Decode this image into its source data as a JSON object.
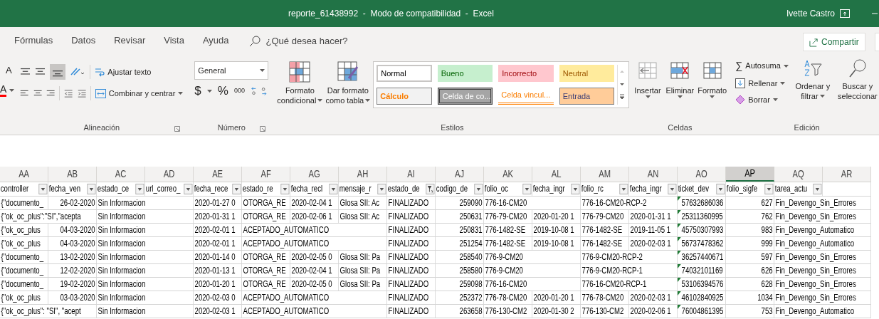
{
  "window": {
    "title": "reporte_61438992  -  Modo de compatibilidad  -  Excel",
    "user": "Ivette Castro"
  },
  "tabs": [
    {
      "label": "Fórmulas",
      "selected": false
    },
    {
      "label": "Datos",
      "selected": false
    },
    {
      "label": "Revisar",
      "selected": false
    },
    {
      "label": "Vista",
      "selected": false
    },
    {
      "label": "Ayuda",
      "selected": false
    }
  ],
  "search": {
    "placeholder": "¿Qué desea hacer?"
  },
  "share_button": "Compartir",
  "font_group": {
    "increase_size_letter": "A",
    "font_color_letter": "A"
  },
  "alignment_group": {
    "wrap_text": "Ajustar texto",
    "merge_center": "Combinar y centrar",
    "label": "Alineación"
  },
  "number_group": {
    "format": "General",
    "currency": "$",
    "percent": "%",
    "thousands": "000",
    "label": "Número"
  },
  "styles_group": {
    "conditional": [
      "Formato",
      "condicional"
    ],
    "as_table": [
      "Dar formato",
      "como tabla"
    ],
    "label": "Estilos",
    "cell_styles": [
      {
        "label": "Normal",
        "kind": "normal"
      },
      {
        "label": "Bueno",
        "kind": "good"
      },
      {
        "label": "Incorrecto",
        "kind": "bad"
      },
      {
        "label": "Neutral",
        "kind": "neutral"
      },
      {
        "label": "Cálculo",
        "kind": "calc"
      },
      {
        "label": "Celda de co...",
        "kind": "check"
      },
      {
        "label": "Celda vincul...",
        "kind": "linked"
      },
      {
        "label": "Entrada",
        "kind": "input"
      }
    ]
  },
  "cells_group": {
    "insert": "Insertar",
    "delete": "Eliminar",
    "format": "Formato",
    "label": "Celdas"
  },
  "editing_group": {
    "autosum_symbol": "∑",
    "autosum": "Autosuma",
    "fill": "Rellenar",
    "clear": "Borrar",
    "sort": [
      "Ordenar y",
      "filtrar"
    ],
    "find": [
      "Buscar y",
      "seleccionar"
    ],
    "label": "Edición"
  },
  "sheet": {
    "columns": [
      {
        "letter": "AA",
        "header": "controller",
        "kind": "text",
        "selected": false
      },
      {
        "letter": "AB",
        "header": "fecha_ven",
        "kind": "number",
        "selected": false
      },
      {
        "letter": "AC",
        "header": "estado_ce",
        "kind": "text",
        "selected": false
      },
      {
        "letter": "AD",
        "header": "url_correo_",
        "selected": false
      },
      {
        "letter": "AE",
        "header": "fecha_rece",
        "kind": "text",
        "selected": false
      },
      {
        "letter": "AF",
        "header": "estado_re",
        "kind": "text",
        "selected": false
      },
      {
        "letter": "AG",
        "header": "fecha_recl",
        "kind": "text",
        "selected": false
      },
      {
        "letter": "AH",
        "header": "mensaje_r",
        "kind": "text",
        "selected": false
      },
      {
        "letter": "AI",
        "header": "estado_de",
        "kind": "text",
        "selected": false,
        "filtered": true
      },
      {
        "letter": "AJ",
        "header": "codigo_de",
        "kind": "number",
        "selected": false
      },
      {
        "letter": "AK",
        "header": "folio_oc",
        "kind": "text",
        "selected": false
      },
      {
        "letter": "AL",
        "header": "fecha_ingr",
        "kind": "text",
        "selected": false
      },
      {
        "letter": "AM",
        "header": "folio_rc",
        "kind": "text",
        "selected": false
      },
      {
        "letter": "AN",
        "header": "fecha_ingr",
        "kind": "text",
        "selected": false
      },
      {
        "letter": "AO",
        "header": "ticket_dev",
        "kind": "text",
        "selected": false,
        "flagged": true
      },
      {
        "letter": "AP",
        "header": "folio_sigfe",
        "kind": "number",
        "selected": true
      },
      {
        "letter": "AQ",
        "header": "tarea_actu",
        "kind": "text",
        "selected": false
      },
      {
        "letter": "AR",
        "selected": false
      }
    ],
    "rows": [
      [
        "{\"documento_",
        "26-02-2020",
        "Sin Informacion",
        null,
        "2020-01-27 0",
        "OTORGA_RE",
        "2020-02-04 1",
        "Glosa SII: Ac",
        "FINALIZADO",
        "259090",
        "776-16-CM20",
        null,
        "776-16-CM20-RCP-2",
        null,
        "57632686036",
        "627",
        "Fin_Devengo_Sin_Errores",
        null
      ],
      [
        "{\"ok_oc_plus\":\"SI\",\"acepta",
        null,
        "Sin Informacion",
        null,
        "2020-01-31 1",
        "OTORGA_RE",
        "2020-02-06 1",
        "Glosa SII: Ac",
        "FINALIZADO",
        "250631",
        "776-79-CM20",
        "2020-01-20 1",
        "776-79-CM20",
        "2020-01-31 1",
        "25311360995",
        "762",
        "Fin_Devengo_Sin_Errores",
        null
      ],
      [
        "{\"ok_oc_plus",
        "04-03-2020",
        "Sin Informacion",
        null,
        "2020-02-01 1",
        "ACEPTADO_AUTOMATICO",
        null,
        null,
        "FINALIZADO",
        "250831",
        "776-1482-SE",
        "2019-10-08 1",
        "776-1482-SE",
        "2019-11-05 1",
        "45750307993",
        "983",
        "Fin_Devengo_Automatico",
        null
      ],
      [
        "{\"ok_oc_plus",
        "04-03-2020",
        "Sin Informacion",
        null,
        "2020-02-01 1",
        "ACEPTADO_AUTOMATICO",
        null,
        null,
        "FINALIZADO",
        "251254",
        "776-1482-SE",
        "2019-10-08 1",
        "776-1482-SE",
        "2020-02-03 1",
        "56737478362",
        "999",
        "Fin_Devengo_Automatico",
        null
      ],
      [
        "{\"documento_",
        "13-02-2020",
        "Sin Informacion",
        null,
        "2020-01-14 0",
        "OTORGA_RE",
        "2020-02-05 0",
        "Glosa SII: Pa",
        "FINALIZADO",
        "258540",
        "776-9-CM20",
        null,
        "776-9-CM20-RCP-2",
        null,
        "36257440671",
        "597",
        "Fin_Devengo_Sin_Errores",
        null
      ],
      [
        "{\"documento_",
        "12-02-2020",
        "Sin Informacion",
        null,
        "2020-01-13 1",
        "OTORGA_RE",
        "2020-02-04 1",
        "Glosa SII: Pa",
        "FINALIZADO",
        "258580",
        "776-9-CM20",
        null,
        "776-9-CM20-RCP-1",
        null,
        "74032101169",
        "626",
        "Fin_Devengo_Sin_Errores",
        null
      ],
      [
        "{\"documento_",
        "19-02-2020",
        "Sin Informacion",
        null,
        "2020-01-20 1",
        "OTORGA_RE",
        "2020-02-05 0",
        "Glosa SII: Pa",
        "FINALIZADO",
        "259098",
        "776-16-CM20",
        null,
        "776-16-CM20-RCP-1",
        null,
        "53106394576",
        "628",
        "Fin_Devengo_Sin_Errores",
        null
      ],
      [
        "{\"ok_oc_plus",
        "03-03-2020",
        "Sin Informacion",
        null,
        "2020-02-03 0",
        "ACEPTADO_AUTOMATICO",
        null,
        null,
        "FINALIZADO",
        "252372",
        "776-78-CM20",
        "2020-01-20 1",
        "776-78-CM20",
        "2020-02-03 1",
        "46102840925",
        "1034",
        "Fin_Devengo_Sin_Errores",
        null
      ],
      [
        "{\"ok_oc_plus\": \"SI\", \"acept",
        null,
        "Sin Informacion",
        null,
        "2020-02-03 1",
        "ACEPTADO_AUTOMATICO",
        null,
        null,
        "FINALIZADO",
        "263658",
        "776-130-CM2",
        "2020-01-30 2",
        "776-130-CM2",
        "2020-02-06 1",
        "76004861395",
        "753",
        "Fin_Devengo_Automatico",
        null
      ]
    ]
  }
}
